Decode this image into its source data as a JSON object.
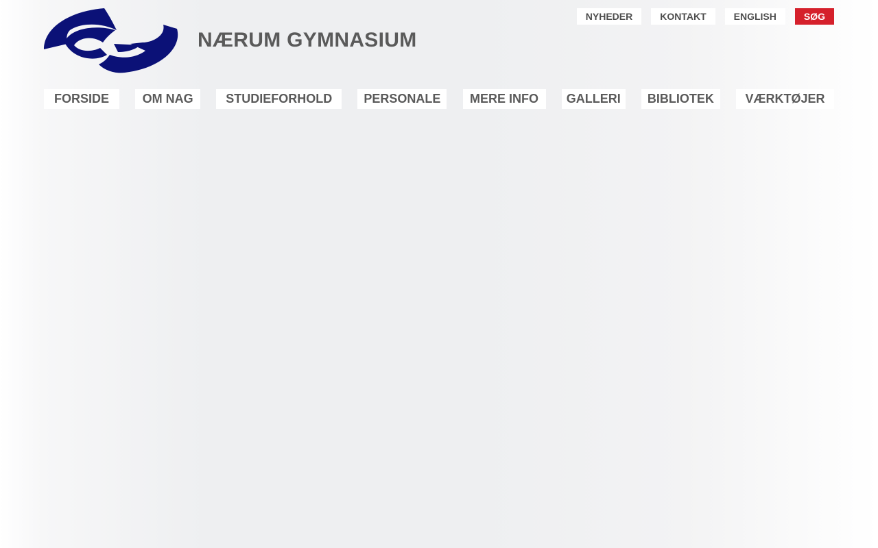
{
  "header": {
    "logo_icon": "nag-logo-icon",
    "title": "NÆRUM GYMNASIUM"
  },
  "utility_nav": [
    {
      "label": "NYHEDER"
    },
    {
      "label": "KONTAKT"
    },
    {
      "label": "ENGLISH"
    },
    {
      "label": "SØG"
    }
  ],
  "main_nav": [
    {
      "label": "FORSIDE"
    },
    {
      "label": "OM NAG"
    },
    {
      "label": "STUDIEFORHOLD"
    },
    {
      "label": "PERSONALE"
    },
    {
      "label": "MERE INFO"
    },
    {
      "label": "GALLERI"
    },
    {
      "label": "BIBLIOTEK"
    },
    {
      "label": "VÆRKTØJER"
    }
  ],
  "colors": {
    "logo_blue": "#0b1177",
    "search_red": "#d5202b",
    "text_gray": "#5a5a5a"
  }
}
